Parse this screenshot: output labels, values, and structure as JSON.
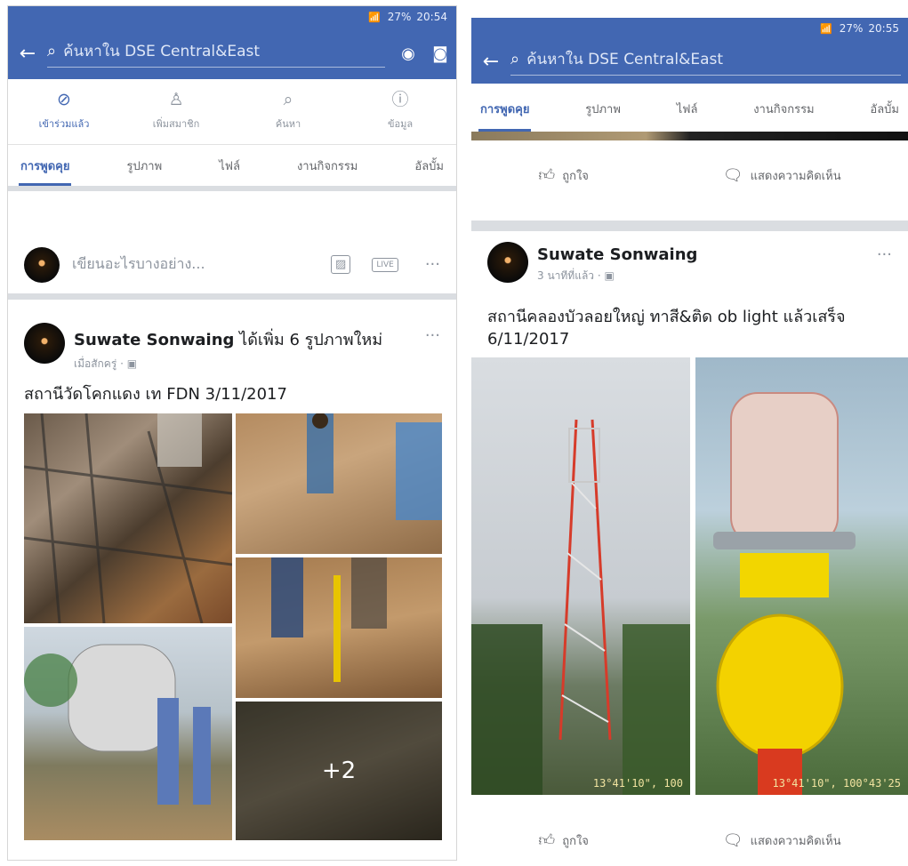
{
  "colors": {
    "fb_blue": "#4267b2",
    "divider": "#dadde1",
    "text_gray": "#8d949e"
  },
  "left": {
    "status": {
      "icons": "wifi signal",
      "battery": "27%",
      "time": "20:54"
    },
    "search_placeholder": "ค้นหาใน DSE Central&East",
    "actions": [
      {
        "label": "เข้าร่วมแล้ว",
        "icon": "check-circle-icon"
      },
      {
        "label": "เพิ่มสมาชิก",
        "icon": "add-person-icon"
      },
      {
        "label": "ค้นหา",
        "icon": "search-icon"
      },
      {
        "label": "ข้อมูล",
        "icon": "info-icon"
      }
    ],
    "tabs": [
      "การพูดคุย",
      "รูปภาพ",
      "ไฟล์",
      "งานกิจกรรม",
      "อัลบั้ม"
    ],
    "composer_placeholder": "เขียนอะไรบางอย่าง...",
    "composer_live": "LIVE",
    "post": {
      "author": "Suwate Sonwaing",
      "action": "ได้เพิ่ม 6 รูปภาพใหม่",
      "time": "เมื่อสักครู่ · ▣",
      "text": "สถานีวัดโคกแดง เท FDN 3/11/2017",
      "more_photos": "+2"
    }
  },
  "right": {
    "status": {
      "icons": "wifi signal",
      "battery": "27%",
      "time": "20:55"
    },
    "search_placeholder": "ค้นหาใน DSE Central&East",
    "tabs": [
      "การพูดคุย",
      "รูปภาพ",
      "ไฟล์",
      "งานกิจกรรม",
      "อัลบั้ม"
    ],
    "reactions": {
      "like": "ถูกใจ",
      "comment": "แสดงความคิดเห็น"
    },
    "post": {
      "author": "Suwate Sonwaing",
      "time": "3 นาทีที่แล้ว · ▣",
      "text": "สถานีคลองบัวลอยใหญ่ ทาสี&ติด ob light แล้วเสร็จ 6/11/2017",
      "photo1_coord": "13°41'10\", 100",
      "photo2_coord": "13°41'10\", 100°43'25"
    }
  }
}
